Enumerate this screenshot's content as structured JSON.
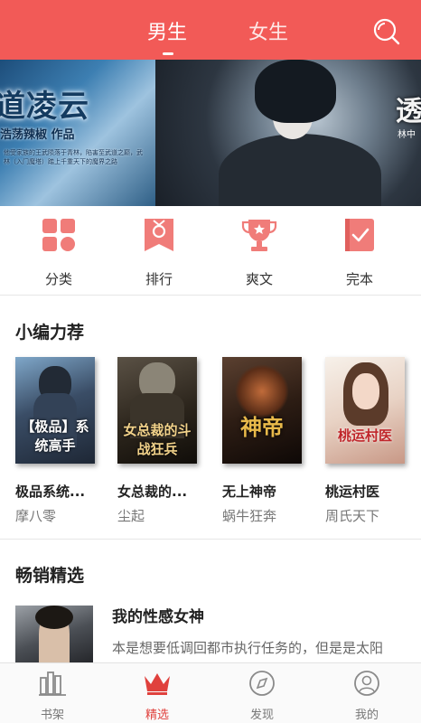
{
  "header": {
    "tabs": [
      {
        "label": "男生",
        "active": true
      },
      {
        "label": "女生",
        "active": false
      }
    ],
    "search_icon": "search-icon",
    "accent_color": "#f25a57"
  },
  "banner": {
    "left_title": "道凌云",
    "left_author": "浩荡辣椒 作品",
    "left_blurb": "他受家族的王武陨落于青林，陷害至武道之巅，武林（入门魔塔）踏上千重天下的魔界之路",
    "right_title": "透",
    "right_author": "林中"
  },
  "quicknav": [
    {
      "label": "分类",
      "icon": "category-grid-icon"
    },
    {
      "label": "排行",
      "icon": "ranking-ribbon-icon"
    },
    {
      "label": "爽文",
      "icon": "trophy-icon"
    },
    {
      "label": "完本",
      "icon": "complete-book-icon"
    }
  ],
  "recommend": {
    "title": "小编力荐",
    "books": [
      {
        "name": "极品系统...",
        "author": "摩八零",
        "cover_text": "【极品】系统高手"
      },
      {
        "name": "女总裁的...",
        "author": "尘起",
        "cover_text": "女总裁的斗战狂兵"
      },
      {
        "name": "无上神帝",
        "author": "蜗牛狂奔",
        "cover_text": "神帝"
      },
      {
        "name": "桃运村医",
        "author": "周氏天下",
        "cover_text": "桃运村医"
      }
    ]
  },
  "bestseller": {
    "title": "畅销精选",
    "book_title": "我的性感女神",
    "book_desc": "本是想要低调回都市执行任务的，但是是太阳"
  },
  "tabbar": [
    {
      "label": "书架",
      "icon": "bookshelf-icon",
      "active": false
    },
    {
      "label": "精选",
      "icon": "crown-icon",
      "active": true
    },
    {
      "label": "发现",
      "icon": "compass-icon",
      "active": false
    },
    {
      "label": "我的",
      "icon": "user-profile-icon",
      "active": false
    }
  ]
}
